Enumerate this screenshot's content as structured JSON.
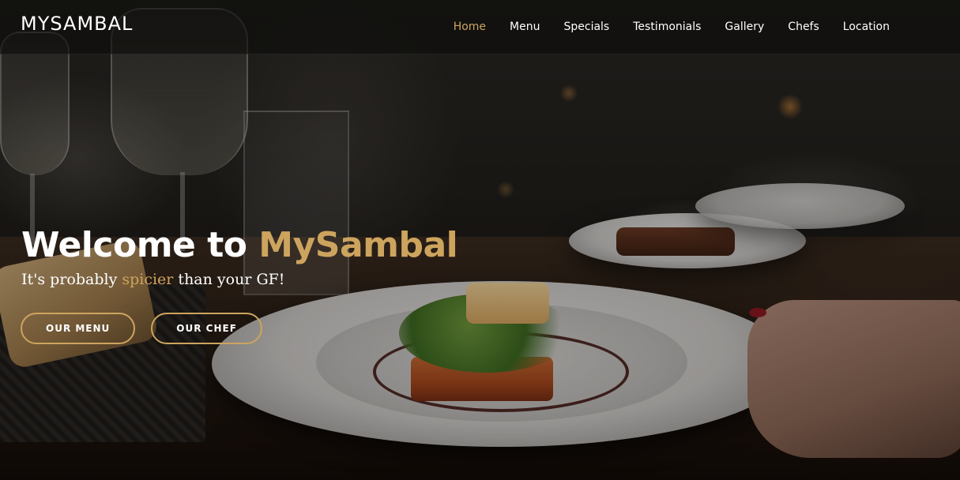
{
  "header": {
    "logo": "MYSAMBAL",
    "nav": [
      {
        "label": "Home",
        "active": true
      },
      {
        "label": "Menu",
        "active": false
      },
      {
        "label": "Specials",
        "active": false
      },
      {
        "label": "Testimonials",
        "active": false
      },
      {
        "label": "Gallery",
        "active": false
      },
      {
        "label": "Chefs",
        "active": false
      },
      {
        "label": "Location",
        "active": false
      }
    ]
  },
  "hero": {
    "title_prefix": "Welcome to ",
    "title_brand": "MySambal",
    "subtitle_before": "It's probably ",
    "subtitle_accent": "spicier",
    "subtitle_after": " than your GF!",
    "buttons": {
      "menu": "OUR MENU",
      "chef": "OUR CHEF"
    }
  },
  "colors": {
    "accent": "#cda45e",
    "header_bg": "#0c0b0a",
    "text": "#ffffff"
  }
}
